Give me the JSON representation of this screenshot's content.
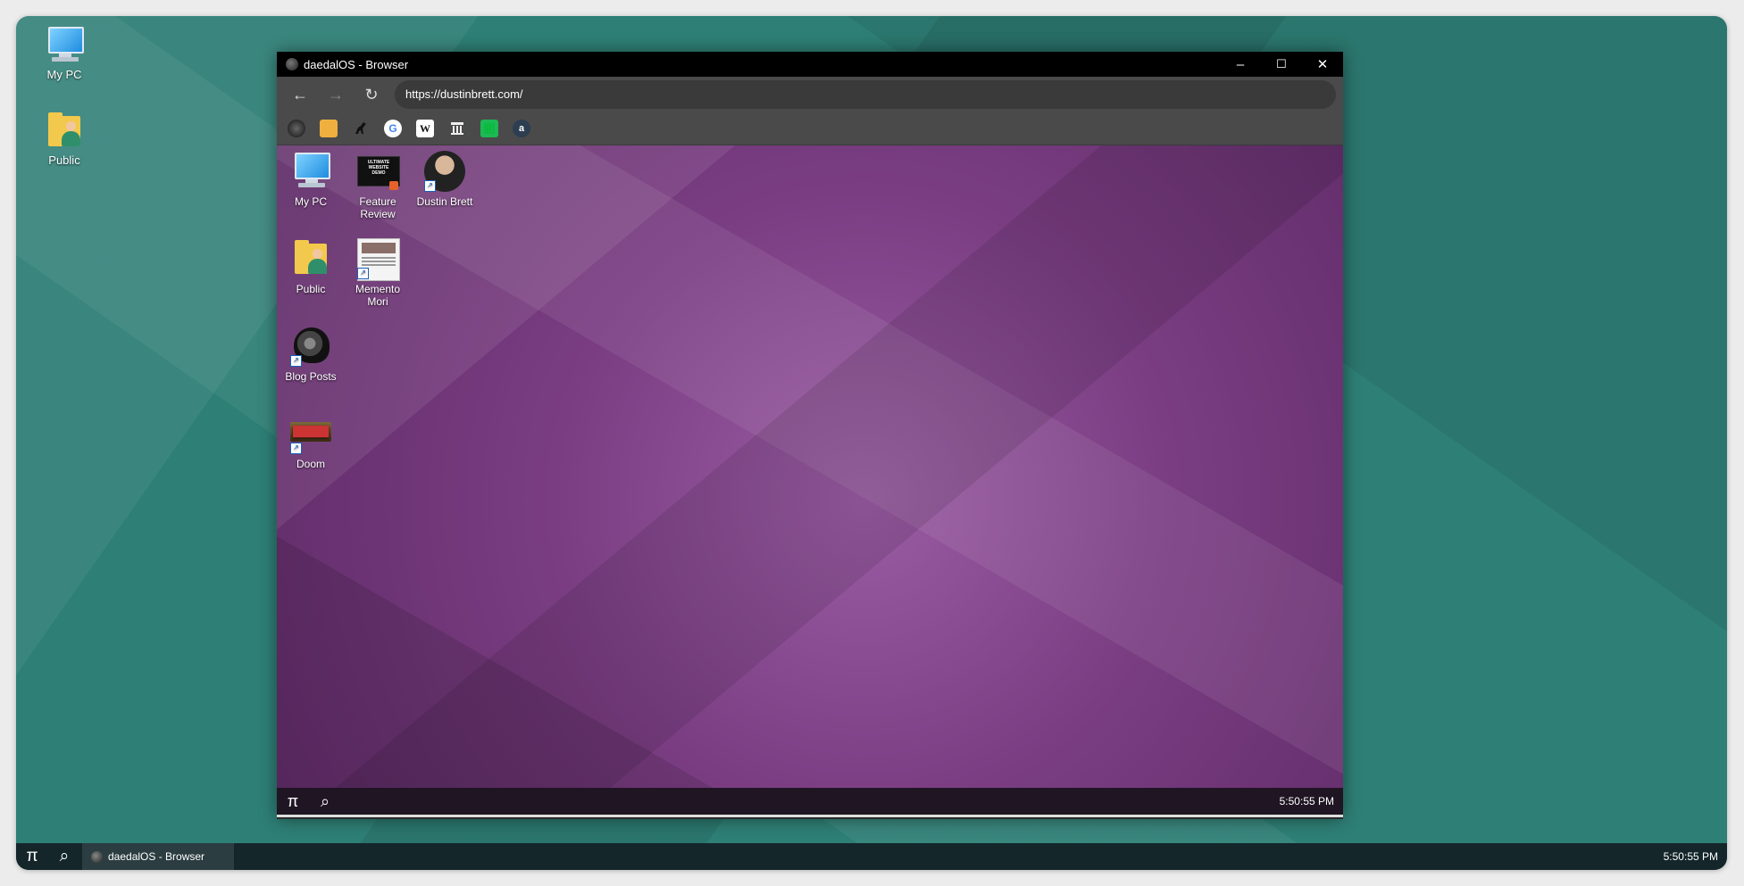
{
  "desktop": {
    "icons": [
      {
        "label": "My PC"
      },
      {
        "label": "Public"
      }
    ]
  },
  "window": {
    "title": "daedalOS - Browser",
    "controls": {
      "minimize": "–",
      "maximize": "☐",
      "close": "✕"
    }
  },
  "toolbar": {
    "back": "←",
    "forward": "→",
    "reload": "↻",
    "url": "https://dustinbrett.com/"
  },
  "bookmarks": [
    {
      "name": "daedalOS"
    },
    {
      "name": "Folder"
    },
    {
      "name": "Dinosaur"
    },
    {
      "name": "Google",
      "text": "G"
    },
    {
      "name": "Wikipedia",
      "text": "W"
    },
    {
      "name": "Archive"
    },
    {
      "name": "Spreadsheet"
    },
    {
      "name": "Account",
      "text": "a"
    }
  ],
  "page": {
    "icons": [
      {
        "label": "My PC"
      },
      {
        "label": "Feature Review"
      },
      {
        "label": "Dustin Brett"
      },
      {
        "label": "Public"
      },
      {
        "label": "Memento Mori"
      },
      {
        "label": "Blog Posts"
      },
      {
        "label": "Doom"
      }
    ],
    "taskbar": {
      "start": "π",
      "search": "⌕",
      "clock": "5:50:55 PM"
    }
  },
  "taskbar": {
    "start": "π",
    "search": "⌕",
    "task_label": "daedalOS - Browser",
    "clock": "5:50:55 PM"
  },
  "colors": {
    "desktop_bg": "#2e7f76",
    "page_bg": "#7a3d82",
    "taskbar_bg": "#14262a"
  }
}
